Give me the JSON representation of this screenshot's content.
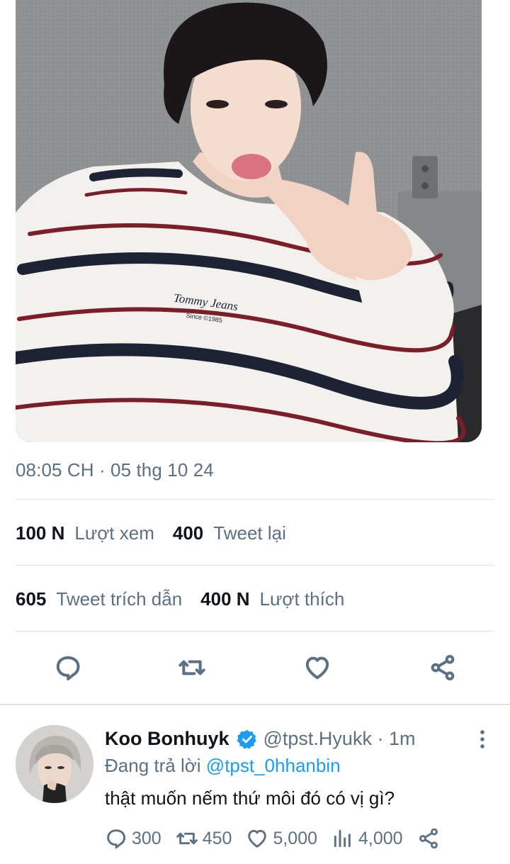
{
  "tweet": {
    "timestamp": "08:05 CH · 05 thg 10 24",
    "stats": {
      "views_count": "100 N",
      "views_label": "Lượt xem",
      "retweets_count": "400",
      "retweets_label": "Tweet lại",
      "quotes_count": "605",
      "quotes_label": "Tweet trích dẫn",
      "likes_count": "400 N",
      "likes_label": "Lượt thích"
    },
    "photo_shirt_text": "Tommy Jeans",
    "photo_shirt_subtext": "Since ©1985"
  },
  "reply": {
    "name": "Koo Bonhuyk",
    "handle": "@tpst.Hyukk · 1m",
    "replying_prefix": "Đang trả lời",
    "replying_mention": "@tpst_0hhanbin",
    "text": "thật muốn nếm thứ môi đó có vị gì?",
    "replies": "300",
    "retweets": "450",
    "likes": "5,000",
    "views": "4,000"
  },
  "icons": {
    "reply": "reply-icon",
    "retweet": "retweet-icon",
    "like": "heart-icon",
    "share": "share-icon",
    "views": "views-icon",
    "verified": "verified-badge-icon",
    "more": "more-icon"
  },
  "colors": {
    "accent": "#1d9bf0",
    "secondary_text": "#5b7083",
    "divider": "#dde3e8"
  }
}
